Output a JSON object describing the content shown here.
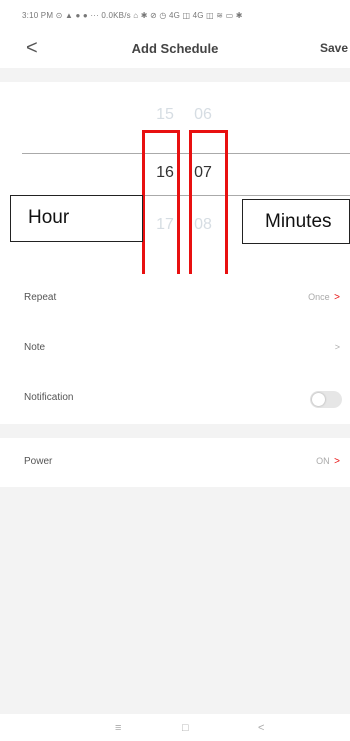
{
  "status_bar": {
    "text": "3:10 PM ⊙ ▲ ● ● ··· 0.0KB/s ⌂ ✱ ⊘ ◷ 4G ◫ 4G ◫ ≋ ▭ ✱"
  },
  "header": {
    "back_icon": "chevron-left-icon",
    "back_label": "<",
    "title": "Add Schedule",
    "save_label": "Save"
  },
  "picker": {
    "hour": {
      "above": "15",
      "selected": "16",
      "below": "17"
    },
    "minute": {
      "above": "06",
      "selected": "07",
      "below": "08"
    }
  },
  "annotations": {
    "hour_label": "Hour",
    "minutes_label": "Minutes",
    "highlight_color": "#e81010"
  },
  "settings": {
    "repeat": {
      "label": "Repeat",
      "value": "Once",
      "chevron": ">"
    },
    "note": {
      "label": "Note",
      "chevron": ">"
    },
    "notification": {
      "label": "Notification",
      "enabled": false
    },
    "power": {
      "label": "Power",
      "value": "ON",
      "chevron": ">"
    }
  },
  "system_nav": {
    "menu": "≡",
    "home": "□",
    "back": "<"
  }
}
